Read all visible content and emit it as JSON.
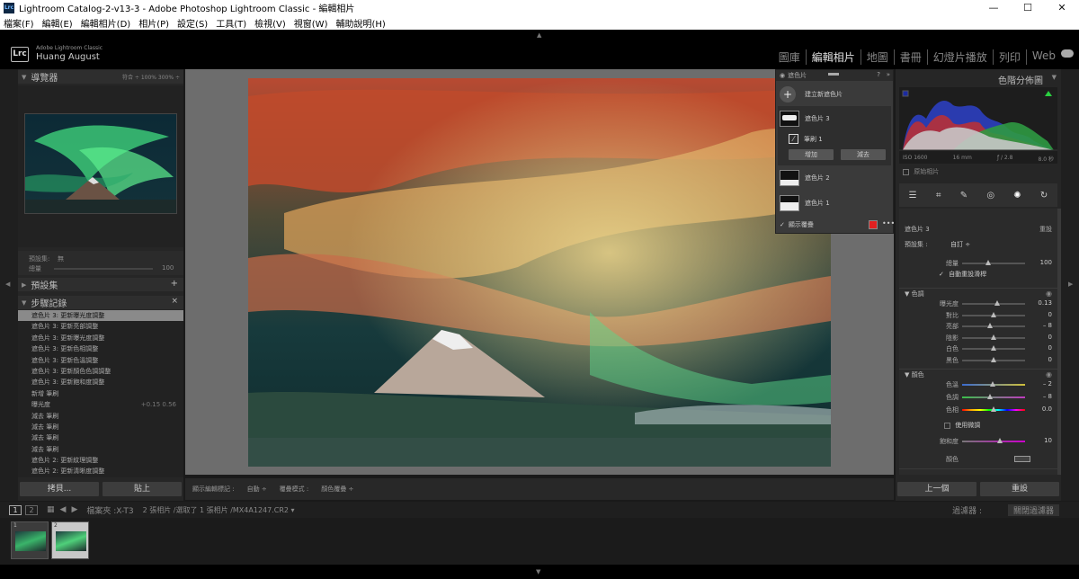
{
  "window": {
    "title": "Lightroom Catalog-2-v13-3 - Adobe Photoshop Lightroom Classic - 編輯相片",
    "app_icon": "Lrc",
    "controls": [
      "—",
      "☐",
      "✕"
    ]
  },
  "menu": [
    "檔案(F)",
    "編輯(E)",
    "編輯相片(D)",
    "相片(P)",
    "設定(S)",
    "工具(T)",
    "檢視(V)",
    "視窗(W)",
    "輔助說明(H)"
  ],
  "identity": {
    "logo": "Lrc",
    "app_line": "Adobe Lightroom Classic",
    "user": "Huang August"
  },
  "modules": [
    "圖庫",
    "編輯相片",
    "地圖",
    "書冊",
    "幻燈片播放",
    "列印",
    "Web"
  ],
  "active_module": "編輯相片",
  "left": {
    "navigator": {
      "title": "導覽器",
      "zoom": "符合 ÷  100%   300% ÷"
    },
    "preset": {
      "label": "預設集:",
      "value": "無",
      "amount_label": "總量",
      "amount_value": "100"
    },
    "presets_title": "預設集",
    "history_title": "步驟記錄",
    "history": [
      {
        "label": "遮色片 3: 更新曝光度調整",
        "value": ""
      },
      {
        "label": "遮色片 3: 更新亮部調整",
        "value": ""
      },
      {
        "label": "遮色片 3: 更新曝光度調整",
        "value": ""
      },
      {
        "label": "遮色片 3: 更新色相調整",
        "value": ""
      },
      {
        "label": "遮色片 3: 更新色溫調整",
        "value": ""
      },
      {
        "label": "遮色片 3: 更新顏色色調調整",
        "value": ""
      },
      {
        "label": "遮色片 3: 更新飽和度調整",
        "value": ""
      },
      {
        "label": "新增 筆刷",
        "value": ""
      },
      {
        "label": "曝光度",
        "value": "+0.15     0.56"
      },
      {
        "label": "減去 筆刷",
        "value": ""
      },
      {
        "label": "減去 筆刷",
        "value": ""
      },
      {
        "label": "減去 筆刷",
        "value": ""
      },
      {
        "label": "減去 筆刷",
        "value": ""
      },
      {
        "label": "遮色片 2: 更新紋理調整",
        "value": ""
      },
      {
        "label": "遮色片 2: 更新清晰度調整",
        "value": ""
      }
    ],
    "copy_button": "拷貝...",
    "paste_button": "貼上"
  },
  "masks": {
    "title": "遮色片",
    "create": "建立新遮色片",
    "items": [
      {
        "name": "遮色片 3",
        "selected": true
      },
      {
        "name": "筆刷 1",
        "selected": false
      },
      {
        "name": "遮色片 2",
        "selected": false
      },
      {
        "name": "遮色片 1",
        "selected": false
      }
    ],
    "add_button": "增加",
    "subtract_button": "減去",
    "show_overlay": "顯示覆疊",
    "overlay_color": "#e02020"
  },
  "toolbar": {
    "show_edit_pins_label": "顯示編輯標記 :",
    "show_edit_pins_value": "自動 ÷",
    "overlay_mode_label": "覆疊模式 :",
    "overlay_mode_value": "顏色覆疊 ÷"
  },
  "right": {
    "histogram_title": "色階分佈圖",
    "meta": {
      "iso": "ISO 1600",
      "focal": "16 mm",
      "aperture": "ƒ / 2.8",
      "shutter": "8.0 秒"
    },
    "original_photo": "原始相片",
    "mask_name": "遮色片 3",
    "reset": "重設",
    "preset_label": "預設集 :",
    "preset_value": "自訂 ÷",
    "amount_label": "總量",
    "amount_value": "100",
    "auto_reset_sliders": "自動重設滑桿",
    "tone_title": "色調",
    "tone": [
      {
        "label": "曝光度",
        "value": "0.13",
        "pos": 0.55
      },
      {
        "label": "對比",
        "value": "0",
        "pos": 0.5
      },
      {
        "label": "亮部",
        "value": "– 8",
        "pos": 0.44
      },
      {
        "label": "陰影",
        "value": "0",
        "pos": 0.5
      },
      {
        "label": "白色",
        "value": "0",
        "pos": 0.5
      },
      {
        "label": "黑色",
        "value": "0",
        "pos": 0.5
      }
    ],
    "color_title": "顏色",
    "color": [
      {
        "label": "色溫",
        "value": "– 2",
        "pos": 0.49
      },
      {
        "label": "色調",
        "value": "– 8",
        "pos": 0.44
      },
      {
        "label": "色相",
        "value": "0.0",
        "pos": 0.5
      }
    ],
    "use_fine": "使用微調",
    "saturation_label": "飽和度",
    "saturation_value": "10",
    "saturation_pos": 0.6,
    "color_swatch_label": "顏色",
    "prev_button": "上一個",
    "reset_button": "重設"
  },
  "filmstrip": {
    "pages": [
      "1",
      "2"
    ],
    "source": "檔案夾 :X-T3",
    "info": "2 張相片 /選取了 1 張相片 /MX4A1247.CR2 ▾",
    "filter_label": "過濾器 :",
    "filter_value": "關閉過濾器",
    "thumbs": [
      "1",
      "2"
    ]
  }
}
